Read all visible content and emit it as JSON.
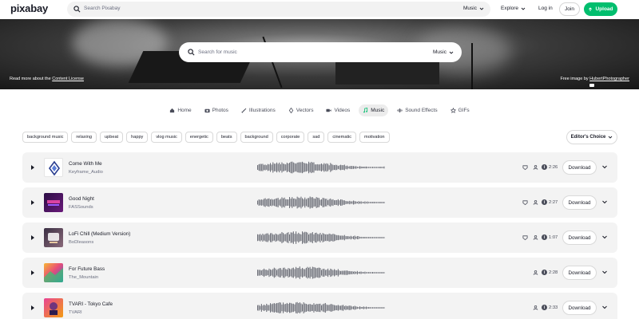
{
  "topbar": {
    "logo": "pixabay",
    "search_placeholder": "Search Pixabay",
    "search_type": "Music",
    "explore": "Explore",
    "login": "Log in",
    "join": "Join",
    "upload": "Upload"
  },
  "hero": {
    "search_placeholder": "Search for music",
    "search_type": "Music",
    "license_prefix": "Read more about the",
    "license_link": "Content License",
    "credit_prefix": "Free image by",
    "credit_link": "HubertPhotographer"
  },
  "tabs": [
    {
      "label": "Home",
      "icon": "home-icon",
      "active": false
    },
    {
      "label": "Photos",
      "icon": "camera-icon",
      "active": false
    },
    {
      "label": "Illustrations",
      "icon": "brush-icon",
      "active": false
    },
    {
      "label": "Vectors",
      "icon": "pen-icon",
      "active": false
    },
    {
      "label": "Videos",
      "icon": "video-icon",
      "active": false
    },
    {
      "label": "Music",
      "icon": "music-note-icon",
      "active": true
    },
    {
      "label": "Sound Effects",
      "icon": "sound-wave-icon",
      "active": false
    },
    {
      "label": "GIFs",
      "icon": "gif-icon",
      "active": false
    }
  ],
  "tags": [
    "background music",
    "relaxing",
    "upbeat",
    "happy",
    "vlog music",
    "energetic",
    "beats",
    "background",
    "corporate",
    "sad",
    "cinematic",
    "motivation"
  ],
  "sort": {
    "label": "Editor's Choice"
  },
  "tracks": [
    {
      "title": "Come With Me",
      "artist": "Keyframe_Audio",
      "duration": "2:26",
      "download": "Download",
      "has_crown": true
    },
    {
      "title": "Good Night",
      "artist": "FASSounds",
      "duration": "2:27",
      "download": "Download",
      "has_crown": true
    },
    {
      "title": "LoFi Chill (Medium Version)",
      "artist": "BoDleasons",
      "duration": "1:07",
      "download": "Download",
      "has_crown": true
    },
    {
      "title": "For Future Bass",
      "artist": "The_Mountain",
      "duration": "2:28",
      "download": "Download",
      "has_crown": false
    },
    {
      "title": "TVARI - Tokyo Cafe",
      "artist": "TVARI",
      "duration": "2:33",
      "download": "Download",
      "has_crown": false
    }
  ],
  "colors": {
    "brand_green": "#02be6e",
    "text": "#191b26",
    "muted": "#6b6f80",
    "track_bg": "#f3f3f3",
    "wave": "#6e7079"
  }
}
